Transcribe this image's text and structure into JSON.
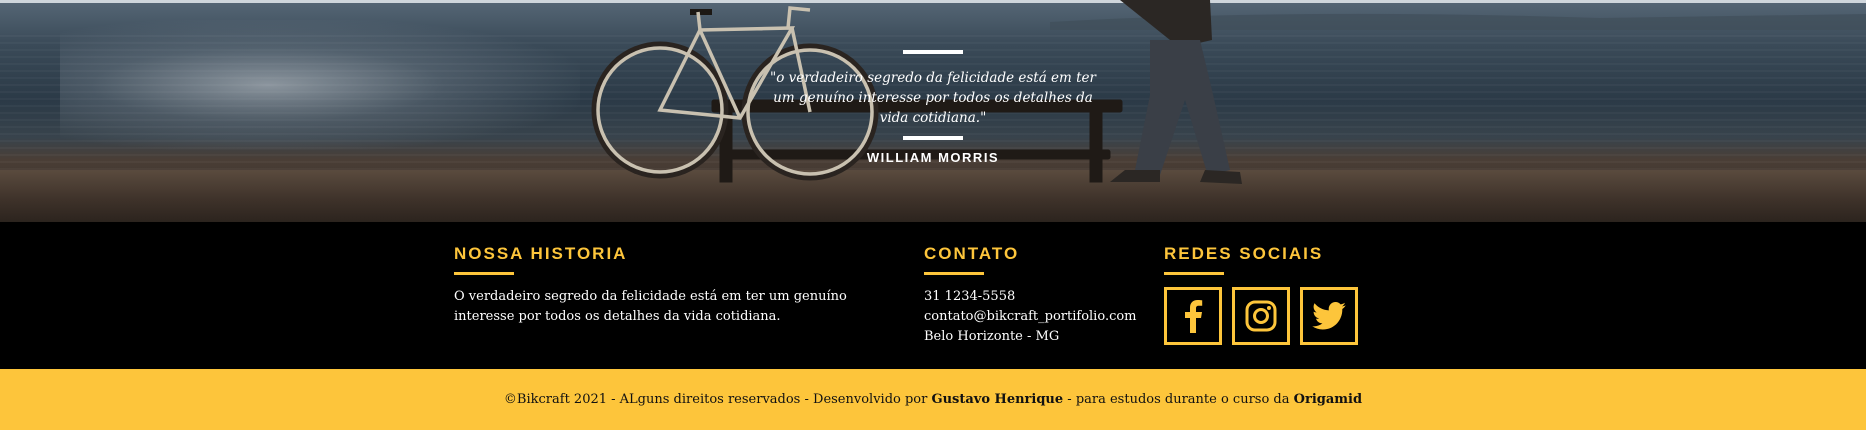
{
  "quote": {
    "text": "\"o verdadeiro segredo da felicidade está em ter um genuíno interesse por todos os detalhes da vida cotidiana.\"",
    "author": "WILLIAM MORRIS"
  },
  "footer": {
    "historia": {
      "title": "NOSSA HISTORIA",
      "text": "O verdadeiro segredo da felicidade está em ter um genuíno interesse por todos os detalhes da vida cotidiana."
    },
    "contato": {
      "title": "CONTATO",
      "items": [
        "31 1234-5558",
        "contato@bikcraft_portifolio.com",
        "Belo Horizonte - MG"
      ]
    },
    "redes": {
      "title": "REDES SOCIAIS",
      "icons": [
        "facebook-icon",
        "instagram-icon",
        "twitter-icon"
      ]
    }
  },
  "copyright": {
    "prefix": "©Bikcraft 2021 - ALguns direitos reservados - Desenvolvido por ",
    "author": "Gustavo Henrique",
    "middle": " - para estudos durante o curso da ",
    "school": "Origamid"
  },
  "colors": {
    "accent": "#fdc53b",
    "footer_bg": "#000000",
    "text": "#ffffff"
  }
}
